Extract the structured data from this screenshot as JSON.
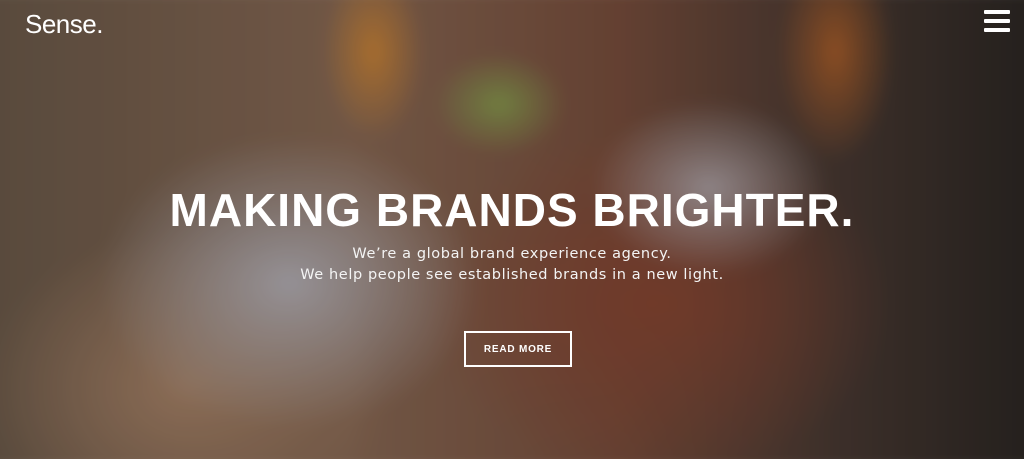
{
  "header": {
    "logo_text": "Sense.",
    "menu_icon": "hamburger-menu-icon"
  },
  "hero": {
    "headline": "MAKING BRANDS BRIGHTER.",
    "subline_1": "We’re a global brand experience agency.",
    "subline_2": "We help people see established brands in a new light.",
    "cta_label": "READ MORE"
  },
  "colors": {
    "text": "#ffffff"
  }
}
